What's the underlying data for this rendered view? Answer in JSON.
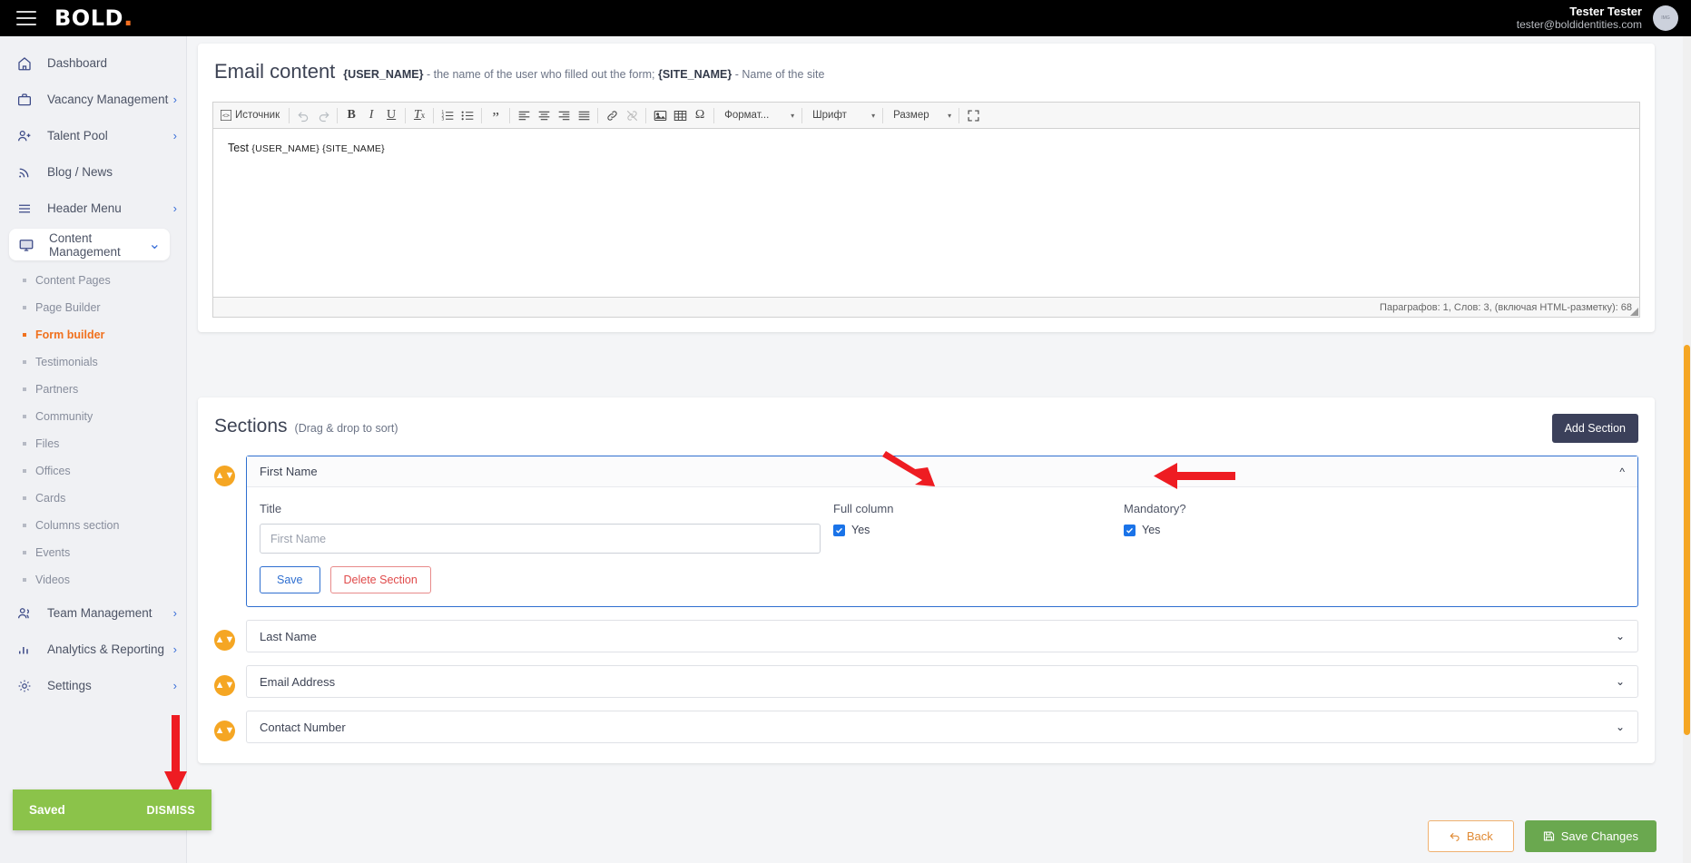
{
  "topbar": {
    "menu_icon": "hamburger-icon",
    "logo_text": "BOLD",
    "logo_dot": ".",
    "user_name": "Tester Tester",
    "user_email": "tester@boldidentities.com",
    "avatar_text": "IMG"
  },
  "sidebar": {
    "items": [
      {
        "label": "Dashboard",
        "icon": "home-icon",
        "chevron": "",
        "active": false
      },
      {
        "label": "Vacancy Management",
        "icon": "briefcase-icon",
        "chevron": "›",
        "active": false
      },
      {
        "label": "Talent Pool",
        "icon": "user-plus-icon",
        "chevron": "›",
        "active": false
      },
      {
        "label": "Blog / News",
        "icon": "rss-icon",
        "chevron": "",
        "active": false
      },
      {
        "label": "Header Menu",
        "icon": "menu-lines-icon",
        "chevron": "›",
        "active": false
      },
      {
        "label": "Content Management",
        "icon": "monitor-icon",
        "chevron": "⌄",
        "active": true
      }
    ],
    "subitems": [
      {
        "label": "Content Pages",
        "selected": false
      },
      {
        "label": "Page Builder",
        "selected": false
      },
      {
        "label": "Form builder",
        "selected": true
      },
      {
        "label": "Testimonials",
        "selected": false
      },
      {
        "label": "Partners",
        "selected": false
      },
      {
        "label": "Community",
        "selected": false
      },
      {
        "label": "Files",
        "selected": false
      },
      {
        "label": "Offices",
        "selected": false
      },
      {
        "label": "Cards",
        "selected": false
      },
      {
        "label": "Columns section",
        "selected": false
      },
      {
        "label": "Events",
        "selected": false
      },
      {
        "label": "Videos",
        "selected": false
      }
    ],
    "bottom_items": [
      {
        "label": "Team Management",
        "icon": "people-icon",
        "chevron": "›"
      },
      {
        "label": "Analytics & Reporting",
        "icon": "bar-chart-icon",
        "chevron": "›"
      },
      {
        "label": "Settings",
        "icon": "gear-icon",
        "chevron": "›"
      }
    ]
  },
  "email_content": {
    "title": "Email content",
    "hint_1": "{USER_NAME}",
    "hint_1_rest": " - the name of the user who filled out the form; ",
    "hint_2": "{SITE_NAME}",
    "hint_2_rest": " - Name of the site",
    "editor": {
      "source_label": "Источник",
      "format_label": "Формат...",
      "font_label": "Шрифт",
      "size_label": "Размер",
      "body_text": "Test ",
      "body_token_1": "{USER_NAME}",
      "body_token_2": "{SITE_NAME}",
      "status": "Параграфов: 1, Слов: 3, (включая HTML-разметку): 68",
      "buttons": [
        "bold",
        "italic",
        "underline",
        "remove-format",
        "numbered-list",
        "bulleted-list",
        "blockquote",
        "align-left",
        "align-center",
        "align-right",
        "align-justify",
        "link",
        "unlink",
        "image",
        "table",
        "special-char",
        "maximize"
      ]
    }
  },
  "sections": {
    "title": "Sections",
    "subtitle": "(Drag & drop to sort)",
    "add_button": "Add Section",
    "list": [
      {
        "name": "First Name",
        "expanded": true,
        "title_label": "Title",
        "title_placeholder": "First Name",
        "title_value": "",
        "full_column_label": "Full column",
        "full_column_checked_label": "Yes",
        "full_column_checked": true,
        "mandatory_label": "Mandatory?",
        "mandatory_checked_label": "Yes",
        "mandatory_checked": true,
        "save_label": "Save",
        "delete_label": "Delete Section"
      },
      {
        "name": "Last Name",
        "expanded": false
      },
      {
        "name": "Email Address",
        "expanded": false
      },
      {
        "name": "Contact Number",
        "expanded": false
      }
    ]
  },
  "footer": {
    "back_label": "Back",
    "save_changes_label": "Save Changes"
  },
  "toast": {
    "message": "Saved",
    "dismiss": "DISMISS"
  },
  "colors": {
    "accent_orange": "#f0711e",
    "handle_orange": "#f5a623",
    "toast_green": "#8bc34a",
    "save_green": "#6aa84f",
    "panel_blue": "#2f6fd0",
    "dark_navy": "#3b405a",
    "annotation_red": "#ee1c22"
  }
}
